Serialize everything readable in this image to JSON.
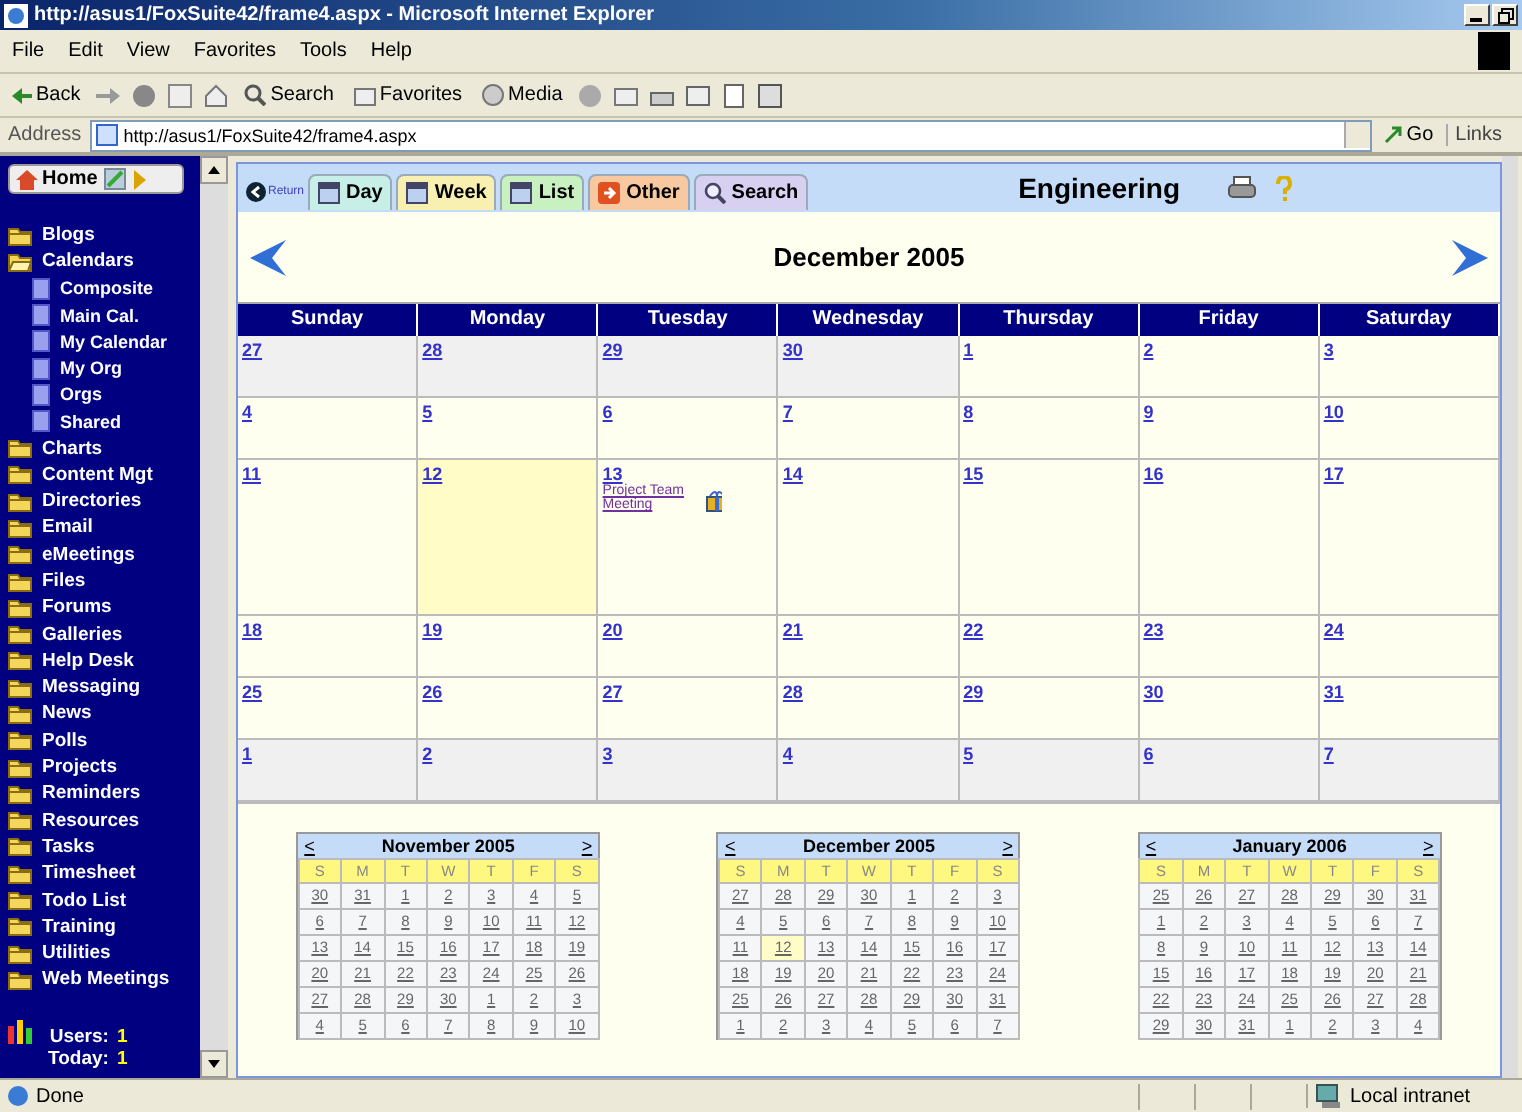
{
  "window": {
    "title": "http://asus1/FoxSuite42/frame4.aspx - Microsoft Internet Explorer"
  },
  "menu": [
    "File",
    "Edit",
    "View",
    "Favorites",
    "Tools",
    "Help"
  ],
  "toolbar": {
    "back": "Back",
    "search": "Search",
    "favorites": "Favorites",
    "media": "Media"
  },
  "address": {
    "label": "Address",
    "value": "http://asus1/FoxSuite42/frame4.aspx",
    "go": "Go",
    "links": "Links"
  },
  "sidebar": {
    "home": "Home",
    "items": [
      {
        "label": "Blogs",
        "expanded": false
      },
      {
        "label": "Calendars",
        "expanded": true,
        "children": [
          {
            "label": "Composite"
          },
          {
            "label": "Main Cal."
          },
          {
            "label": "My Calendar"
          },
          {
            "label": "My Org"
          },
          {
            "label": "Orgs"
          },
          {
            "label": "Shared"
          }
        ]
      },
      {
        "label": "Charts",
        "expanded": false
      },
      {
        "label": "Content Mgt",
        "expanded": false
      },
      {
        "label": "Directories",
        "expanded": false
      },
      {
        "label": "Email",
        "expanded": false
      },
      {
        "label": "eMeetings",
        "expanded": false
      },
      {
        "label": "Files",
        "expanded": false
      },
      {
        "label": "Forums",
        "expanded": false
      },
      {
        "label": "Galleries",
        "expanded": false
      },
      {
        "label": "Help Desk",
        "expanded": false
      },
      {
        "label": "Messaging",
        "expanded": false
      },
      {
        "label": "News",
        "expanded": false
      },
      {
        "label": "Polls",
        "expanded": false
      },
      {
        "label": "Projects",
        "expanded": false
      },
      {
        "label": "Reminders",
        "expanded": false
      },
      {
        "label": "Resources",
        "expanded": false
      },
      {
        "label": "Tasks",
        "expanded": false
      },
      {
        "label": "Timesheet",
        "expanded": false
      },
      {
        "label": "Todo List",
        "expanded": false
      },
      {
        "label": "Training",
        "expanded": false
      },
      {
        "label": "Utilities",
        "expanded": false
      },
      {
        "label": "Web Meetings",
        "expanded": false
      }
    ],
    "stats": [
      {
        "label": "Users:",
        "value": "1"
      },
      {
        "label": "Today:",
        "value": "1"
      }
    ]
  },
  "calendar": {
    "return": "Return",
    "tabs": [
      {
        "label": "Day",
        "kind": "calendar",
        "color": "#c8eee8"
      },
      {
        "label": "Week",
        "kind": "calendar",
        "color": "#f8f0b0"
      },
      {
        "label": "List",
        "kind": "calendar",
        "color": "#c8f0c0"
      },
      {
        "label": "Other",
        "kind": "arrow",
        "color": "#f8c8a0"
      },
      {
        "label": "Search",
        "kind": "search",
        "color": "#d8d0f0"
      }
    ],
    "group": "Engineering",
    "month": "December 2005",
    "weekdays": [
      "Sunday",
      "Monday",
      "Tuesday",
      "Wednesday",
      "Thursday",
      "Friday",
      "Saturday"
    ],
    "weeks": [
      [
        {
          "day": "27",
          "other_month": true,
          "today": false
        },
        {
          "day": "28",
          "other_month": true,
          "today": false
        },
        {
          "day": "29",
          "other_month": true,
          "today": false
        },
        {
          "day": "30",
          "other_month": true,
          "today": false
        },
        {
          "day": "1",
          "other_month": false,
          "today": false
        },
        {
          "day": "2",
          "other_month": false,
          "today": false
        },
        {
          "day": "3",
          "other_month": false,
          "today": false
        }
      ],
      [
        {
          "day": "4",
          "other_month": false,
          "today": false
        },
        {
          "day": "5",
          "other_month": false,
          "today": false
        },
        {
          "day": "6",
          "other_month": false,
          "today": false
        },
        {
          "day": "7",
          "other_month": false,
          "today": false
        },
        {
          "day": "8",
          "other_month": false,
          "today": false
        },
        {
          "day": "9",
          "other_month": false,
          "today": false
        },
        {
          "day": "10",
          "other_month": false,
          "today": false
        }
      ],
      [
        {
          "day": "11",
          "other_month": false,
          "today": false
        },
        {
          "day": "12",
          "other_month": false,
          "today": true
        },
        {
          "day": "13",
          "other_month": false,
          "today": false,
          "events": [
            "Project Team Meeting"
          ]
        },
        {
          "day": "14",
          "other_month": false,
          "today": false
        },
        {
          "day": "15",
          "other_month": false,
          "today": false
        },
        {
          "day": "16",
          "other_month": false,
          "today": false
        },
        {
          "day": "17",
          "other_month": false,
          "today": false
        }
      ],
      [
        {
          "day": "18",
          "other_month": false,
          "today": false
        },
        {
          "day": "19",
          "other_month": false,
          "today": false
        },
        {
          "day": "20",
          "other_month": false,
          "today": false
        },
        {
          "day": "21",
          "other_month": false,
          "today": false
        },
        {
          "day": "22",
          "other_month": false,
          "today": false
        },
        {
          "day": "23",
          "other_month": false,
          "today": false
        },
        {
          "day": "24",
          "other_month": false,
          "today": false
        }
      ],
      [
        {
          "day": "25",
          "other_month": false,
          "today": false
        },
        {
          "day": "26",
          "other_month": false,
          "today": false
        },
        {
          "day": "27",
          "other_month": false,
          "today": false
        },
        {
          "day": "28",
          "other_month": false,
          "today": false
        },
        {
          "day": "29",
          "other_month": false,
          "today": false
        },
        {
          "day": "30",
          "other_month": false,
          "today": false
        },
        {
          "day": "31",
          "other_month": false,
          "today": false
        }
      ],
      [
        {
          "day": "1",
          "other_month": true,
          "today": false
        },
        {
          "day": "2",
          "other_month": true,
          "today": false
        },
        {
          "day": "3",
          "other_month": true,
          "today": false
        },
        {
          "day": "4",
          "other_month": true,
          "today": false
        },
        {
          "day": "5",
          "other_month": true,
          "today": false
        },
        {
          "day": "6",
          "other_month": true,
          "today": false
        },
        {
          "day": "7",
          "other_month": true,
          "today": false
        }
      ]
    ],
    "mini_calendars": [
      {
        "title": "November 2005",
        "prev": "<",
        "next": ">",
        "weekdays": [
          "S",
          "M",
          "T",
          "W",
          "T",
          "F",
          "S"
        ],
        "weeks": [
          [
            {
              "day": "30",
              "today": false
            },
            {
              "day": "31",
              "today": false
            },
            {
              "day": "1",
              "today": false
            },
            {
              "day": "2",
              "today": false
            },
            {
              "day": "3",
              "today": false
            },
            {
              "day": "4",
              "today": false
            },
            {
              "day": "5",
              "today": false
            }
          ],
          [
            {
              "day": "6",
              "today": false
            },
            {
              "day": "7",
              "today": false
            },
            {
              "day": "8",
              "today": false
            },
            {
              "day": "9",
              "today": false
            },
            {
              "day": "10",
              "today": false
            },
            {
              "day": "11",
              "today": false
            },
            {
              "day": "12",
              "today": false
            }
          ],
          [
            {
              "day": "13",
              "today": false
            },
            {
              "day": "14",
              "today": false
            },
            {
              "day": "15",
              "today": false
            },
            {
              "day": "16",
              "today": false
            },
            {
              "day": "17",
              "today": false
            },
            {
              "day": "18",
              "today": false
            },
            {
              "day": "19",
              "today": false
            }
          ],
          [
            {
              "day": "20",
              "today": false
            },
            {
              "day": "21",
              "today": false
            },
            {
              "day": "22",
              "today": false
            },
            {
              "day": "23",
              "today": false
            },
            {
              "day": "24",
              "today": false
            },
            {
              "day": "25",
              "today": false
            },
            {
              "day": "26",
              "today": false
            }
          ],
          [
            {
              "day": "27",
              "today": false
            },
            {
              "day": "28",
              "today": false
            },
            {
              "day": "29",
              "today": false
            },
            {
              "day": "30",
              "today": false
            },
            {
              "day": "1",
              "today": false
            },
            {
              "day": "2",
              "today": false
            },
            {
              "day": "3",
              "today": false
            }
          ],
          [
            {
              "day": "4",
              "today": false
            },
            {
              "day": "5",
              "today": false
            },
            {
              "day": "6",
              "today": false
            },
            {
              "day": "7",
              "today": false
            },
            {
              "day": "8",
              "today": false
            },
            {
              "day": "9",
              "today": false
            },
            {
              "day": "10",
              "today": false
            }
          ]
        ]
      },
      {
        "title": "December 2005",
        "prev": "<",
        "next": ">",
        "weekdays": [
          "S",
          "M",
          "T",
          "W",
          "T",
          "F",
          "S"
        ],
        "weeks": [
          [
            {
              "day": "27",
              "today": false
            },
            {
              "day": "28",
              "today": false
            },
            {
              "day": "29",
              "today": false
            },
            {
              "day": "30",
              "today": false
            },
            {
              "day": "1",
              "today": false
            },
            {
              "day": "2",
              "today": false
            },
            {
              "day": "3",
              "today": false
            }
          ],
          [
            {
              "day": "4",
              "today": false
            },
            {
              "day": "5",
              "today": false
            },
            {
              "day": "6",
              "today": false
            },
            {
              "day": "7",
              "today": false
            },
            {
              "day": "8",
              "today": false
            },
            {
              "day": "9",
              "today": false
            },
            {
              "day": "10",
              "today": false
            }
          ],
          [
            {
              "day": "11",
              "today": false
            },
            {
              "day": "12",
              "today": true
            },
            {
              "day": "13",
              "today": false
            },
            {
              "day": "14",
              "today": false
            },
            {
              "day": "15",
              "today": false
            },
            {
              "day": "16",
              "today": false
            },
            {
              "day": "17",
              "today": false
            }
          ],
          [
            {
              "day": "18",
              "today": false
            },
            {
              "day": "19",
              "today": false
            },
            {
              "day": "20",
              "today": false
            },
            {
              "day": "21",
              "today": false
            },
            {
              "day": "22",
              "today": false
            },
            {
              "day": "23",
              "today": false
            },
            {
              "day": "24",
              "today": false
            }
          ],
          [
            {
              "day": "25",
              "today": false
            },
            {
              "day": "26",
              "today": false
            },
            {
              "day": "27",
              "today": false
            },
            {
              "day": "28",
              "today": false
            },
            {
              "day": "29",
              "today": false
            },
            {
              "day": "30",
              "today": false
            },
            {
              "day": "31",
              "today": false
            }
          ],
          [
            {
              "day": "1",
              "today": false
            },
            {
              "day": "2",
              "today": false
            },
            {
              "day": "3",
              "today": false
            },
            {
              "day": "4",
              "today": false
            },
            {
              "day": "5",
              "today": false
            },
            {
              "day": "6",
              "today": false
            },
            {
              "day": "7",
              "today": false
            }
          ]
        ]
      },
      {
        "title": "January 2006",
        "prev": "<",
        "next": ">",
        "weekdays": [
          "S",
          "M",
          "T",
          "W",
          "T",
          "F",
          "S"
        ],
        "weeks": [
          [
            {
              "day": "25",
              "today": false
            },
            {
              "day": "26",
              "today": false
            },
            {
              "day": "27",
              "today": false
            },
            {
              "day": "28",
              "today": false
            },
            {
              "day": "29",
              "today": false
            },
            {
              "day": "30",
              "today": false
            },
            {
              "day": "31",
              "today": false
            }
          ],
          [
            {
              "day": "1",
              "today": false
            },
            {
              "day": "2",
              "today": false
            },
            {
              "day": "3",
              "today": false
            },
            {
              "day": "4",
              "today": false
            },
            {
              "day": "5",
              "today": false
            },
            {
              "day": "6",
              "today": false
            },
            {
              "day": "7",
              "today": false
            }
          ],
          [
            {
              "day": "8",
              "today": false
            },
            {
              "day": "9",
              "today": false
            },
            {
              "day": "10",
              "today": false
            },
            {
              "day": "11",
              "today": false
            },
            {
              "day": "12",
              "today": false
            },
            {
              "day": "13",
              "today": false
            },
            {
              "day": "14",
              "today": false
            }
          ],
          [
            {
              "day": "15",
              "today": false
            },
            {
              "day": "16",
              "today": false
            },
            {
              "day": "17",
              "today": false
            },
            {
              "day": "18",
              "today": false
            },
            {
              "day": "19",
              "today": false
            },
            {
              "day": "20",
              "today": false
            },
            {
              "day": "21",
              "today": false
            }
          ],
          [
            {
              "day": "22",
              "today": false
            },
            {
              "day": "23",
              "today": false
            },
            {
              "day": "24",
              "today": false
            },
            {
              "day": "25",
              "today": false
            },
            {
              "day": "26",
              "today": false
            },
            {
              "day": "27",
              "today": false
            },
            {
              "day": "28",
              "today": false
            }
          ],
          [
            {
              "day": "29",
              "today": false
            },
            {
              "day": "30",
              "today": false
            },
            {
              "day": "31",
              "today": false
            },
            {
              "day": "1",
              "today": false
            },
            {
              "day": "2",
              "today": false
            },
            {
              "day": "3",
              "today": false
            },
            {
              "day": "4",
              "today": false
            }
          ]
        ]
      }
    ]
  },
  "status_bar": {
    "text": "Done",
    "zone": "Local intranet"
  }
}
